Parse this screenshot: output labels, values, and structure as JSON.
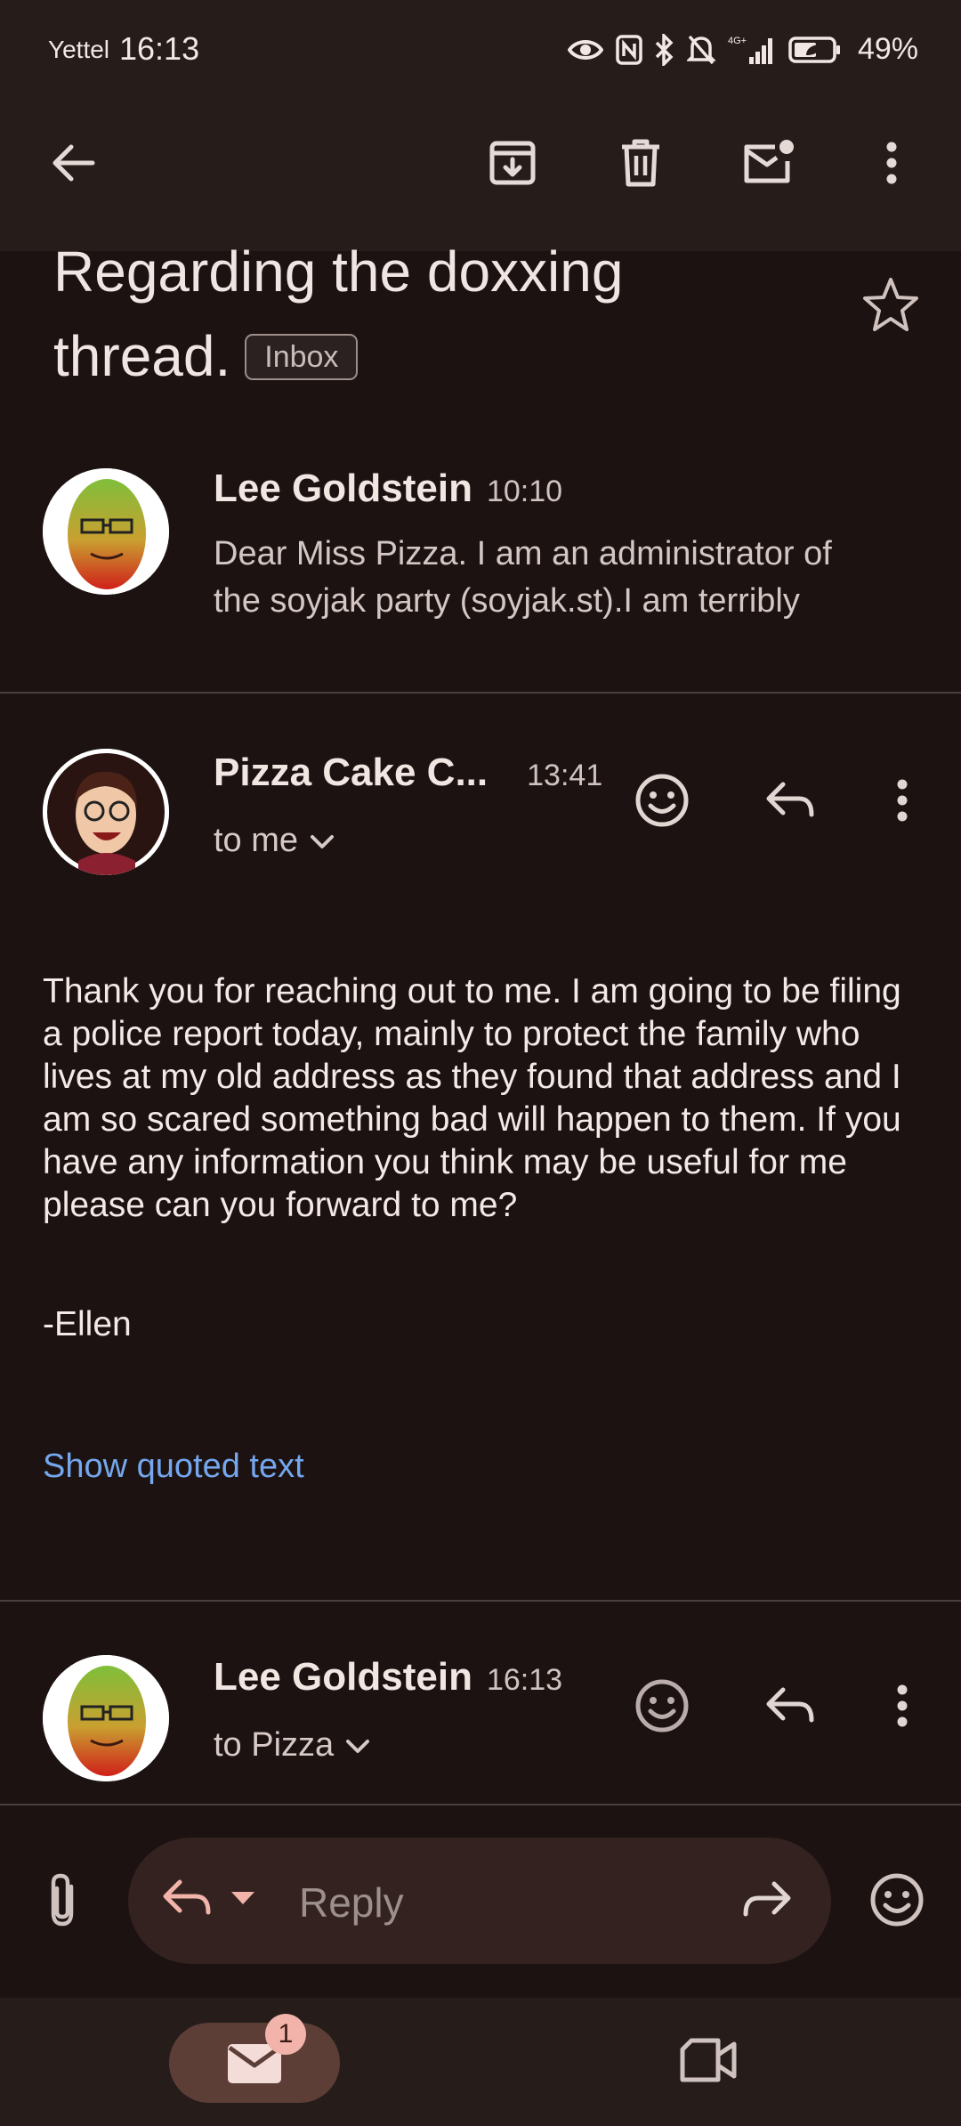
{
  "status_bar": {
    "carrier": "Yettel",
    "time": "16:13",
    "network": "4G+",
    "battery_percent": "49%",
    "icons": [
      "eye-icon",
      "nfc-icon",
      "bluetooth-icon",
      "bell-off-icon",
      "signal-icon",
      "battery-icon"
    ]
  },
  "toolbar": {
    "icons": [
      "back-arrow-icon",
      "archive-icon",
      "delete-icon",
      "mark-unread-icon",
      "more-vert-icon"
    ]
  },
  "subject": {
    "line1": "Regarding the doxxing",
    "line2": "thread.",
    "label": "Inbox"
  },
  "messages": [
    {
      "sender": "Lee Goldstein",
      "time": "10:10",
      "snippet_line1": "Dear Miss Pizza. I am an administrator of",
      "snippet_line2": "the soyjak party (soyjak.st).I am terribly"
    },
    {
      "sender": "Pizza Cake C...",
      "time": "13:41",
      "to": "to me",
      "body": "Thank you for reaching out to me. I am going to be filing a police report today, mainly to protect the family who lives at my old address as they found that address and I am so scared something bad will happen to them. If you have any information you think may be useful for me please can you forward to me?",
      "signoff": "-Ellen",
      "show_quoted": "Show quoted text"
    },
    {
      "sender": "Lee Goldstein",
      "time": "16:13",
      "to": "to Pizza"
    }
  ],
  "reply_bar": {
    "placeholder": "Reply"
  },
  "bottom_nav": {
    "mail_badge": "1"
  },
  "colors": {
    "background": "#1c1211",
    "bar": "#261d1b",
    "link": "#74a7ee",
    "accent": "#f2b3aa",
    "reply_pill": "#33221f"
  }
}
